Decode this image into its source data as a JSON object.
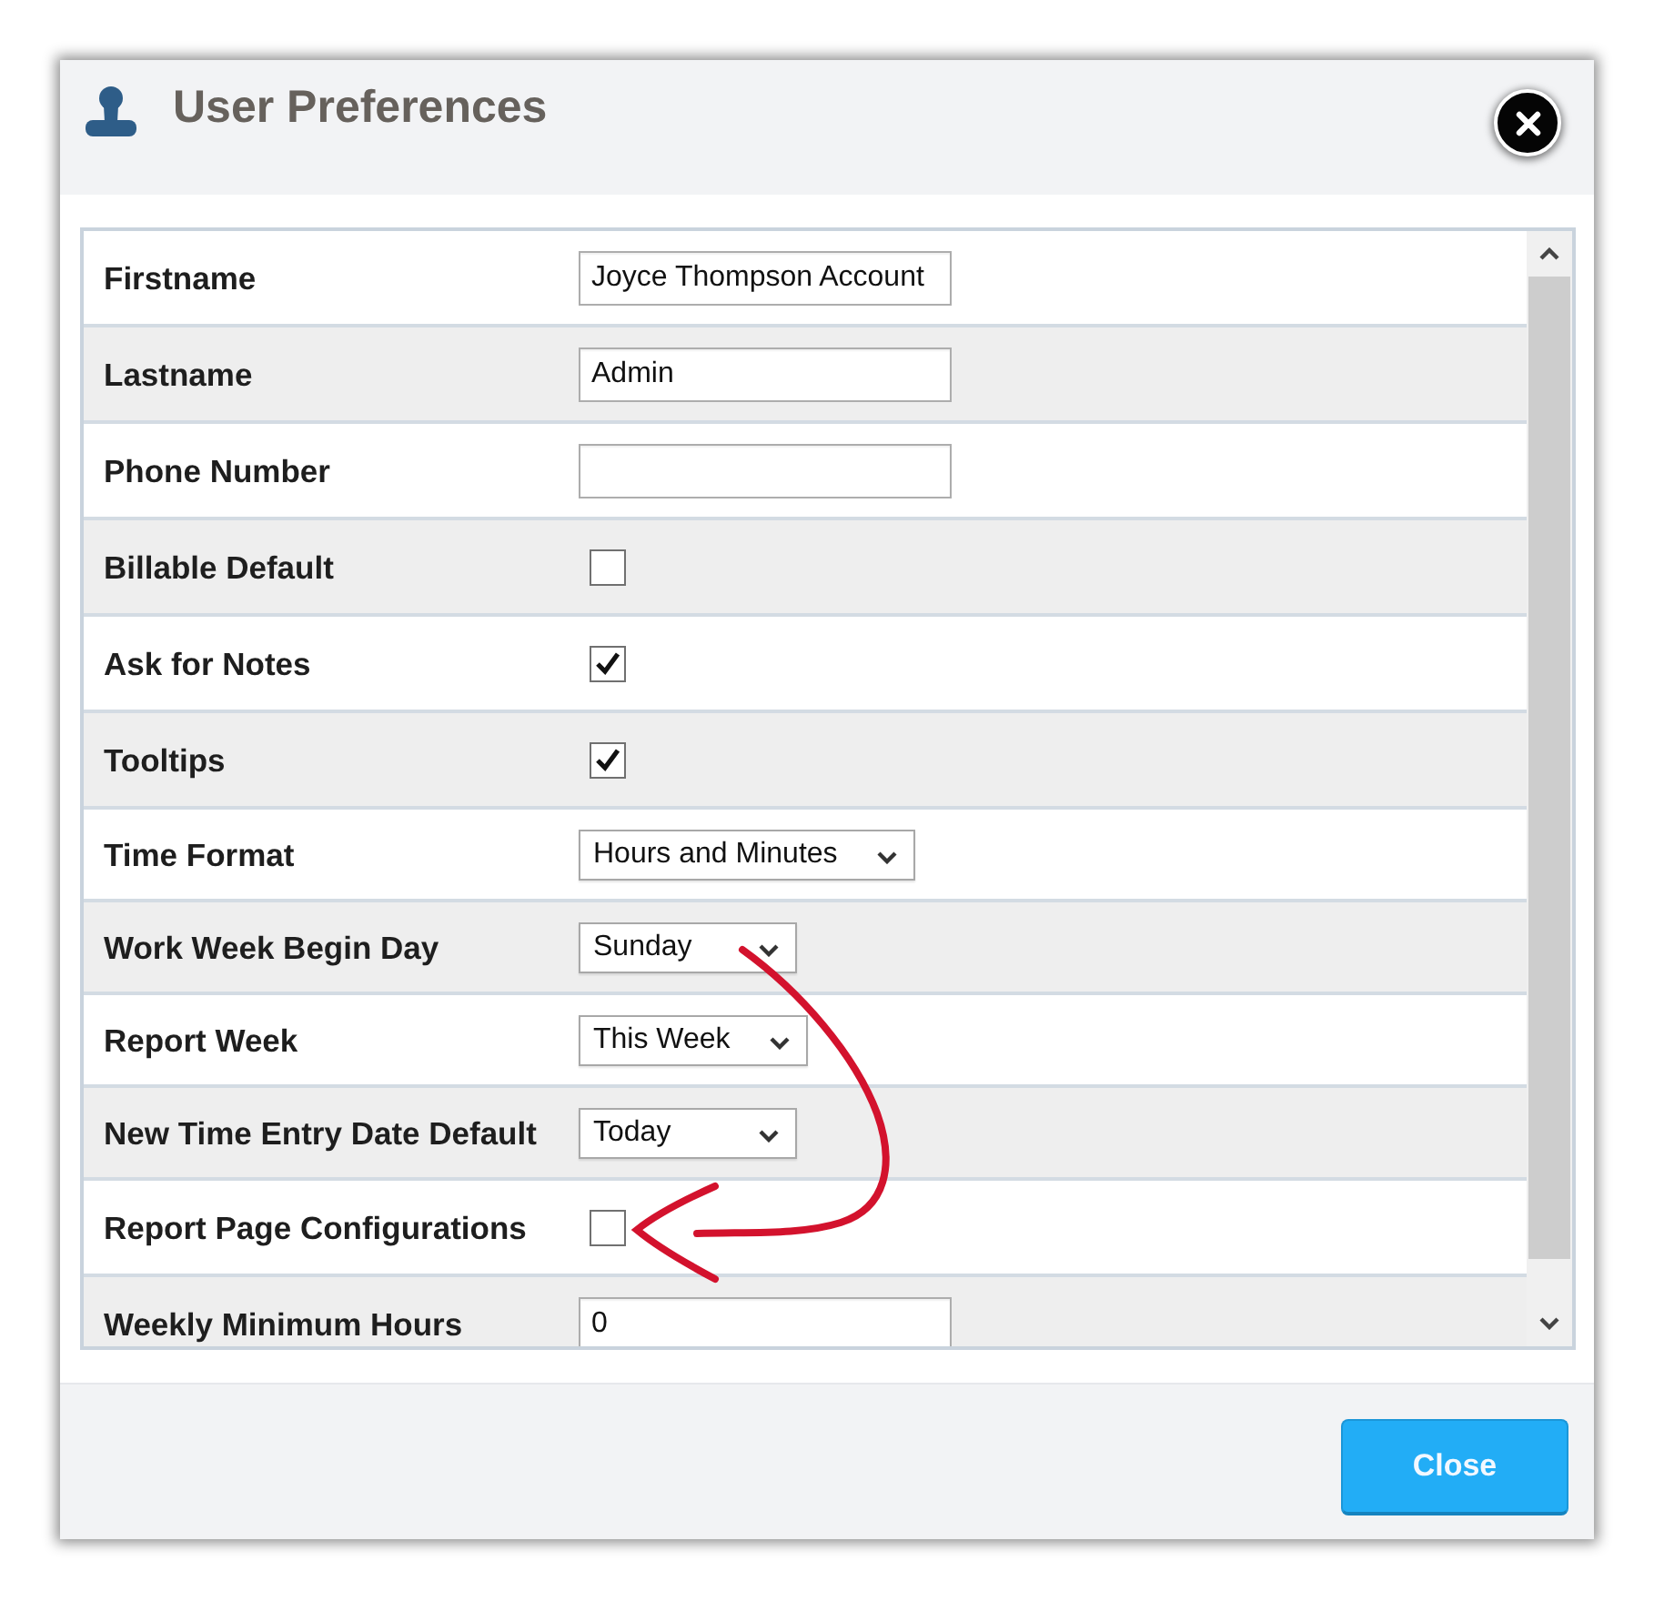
{
  "dialog": {
    "title": "User Preferences"
  },
  "fields": [
    {
      "label": "Firstname",
      "kind": "text",
      "value": "Joyce Thompson Account"
    },
    {
      "label": "Lastname",
      "kind": "text",
      "value": "Admin"
    },
    {
      "label": "Phone Number",
      "kind": "text"
    },
    {
      "label": "Billable Default",
      "kind": "checkbox",
      "checked": false
    },
    {
      "label": "Ask for Notes",
      "kind": "checkbox",
      "checked": true
    },
    {
      "label": "Tooltips",
      "kind": "checkbox",
      "checked": true
    },
    {
      "label": "Time Format",
      "kind": "select",
      "value": "Hours and Minutes"
    },
    {
      "label": "Work Week Begin Day",
      "kind": "select",
      "value": "Sunday"
    },
    {
      "label": "Report Week",
      "kind": "select",
      "value": "This Week"
    },
    {
      "label": "New Time Entry Date Default",
      "kind": "select",
      "value": "Today"
    },
    {
      "label": "Report Page Configurations",
      "kind": "checkbox",
      "checked": false
    },
    {
      "label": "Weekly Minimum Hours",
      "kind": "text",
      "value": "0"
    }
  ],
  "footer": {
    "buttons": [
      "Close"
    ]
  }
}
